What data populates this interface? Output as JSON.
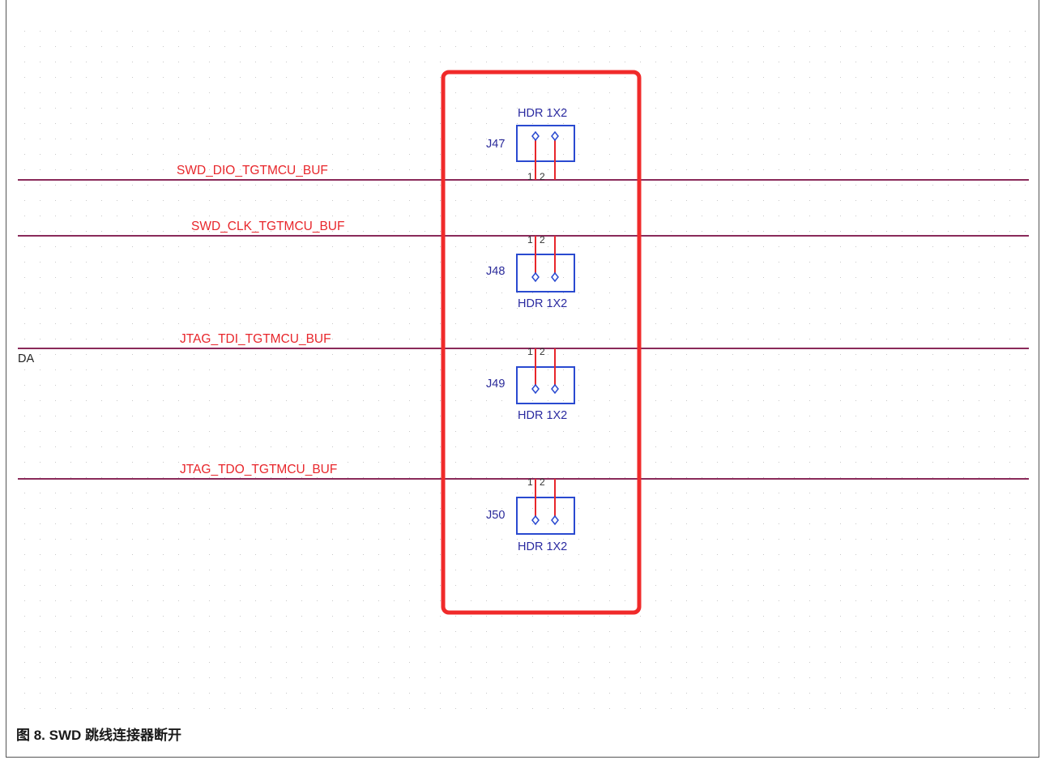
{
  "colors": {
    "net_wire": "#8a2a5a",
    "net_label": "#e8262b",
    "pin_wire": "#e8262b",
    "component_body": "#2a4ad0",
    "highlight_box": "#f02a2a",
    "grid_dot": "#c8c8c8"
  },
  "nets": [
    {
      "name": "SWD_DIO_TGTMCU_BUF"
    },
    {
      "name": "SWD_CLK_TGTMCU_BUF"
    },
    {
      "name": "JTAG_TDI_TGTMCU_BUF"
    },
    {
      "name": "JTAG_TDO_TGTMCU_BUF"
    }
  ],
  "headers": [
    {
      "ref": "J47",
      "part": "HDR 1X2",
      "orientation": "up"
    },
    {
      "ref": "J48",
      "part": "HDR 1X2",
      "orientation": "down"
    },
    {
      "ref": "J49",
      "part": "HDR 1X2",
      "orientation": "down"
    },
    {
      "ref": "J50",
      "part": "HDR 1X2",
      "orientation": "down"
    }
  ],
  "pin_numbers": {
    "pin1": "1",
    "pin2": "2"
  },
  "edge_text": "DA",
  "caption": "图 8. SWD 跳线连接器断开"
}
